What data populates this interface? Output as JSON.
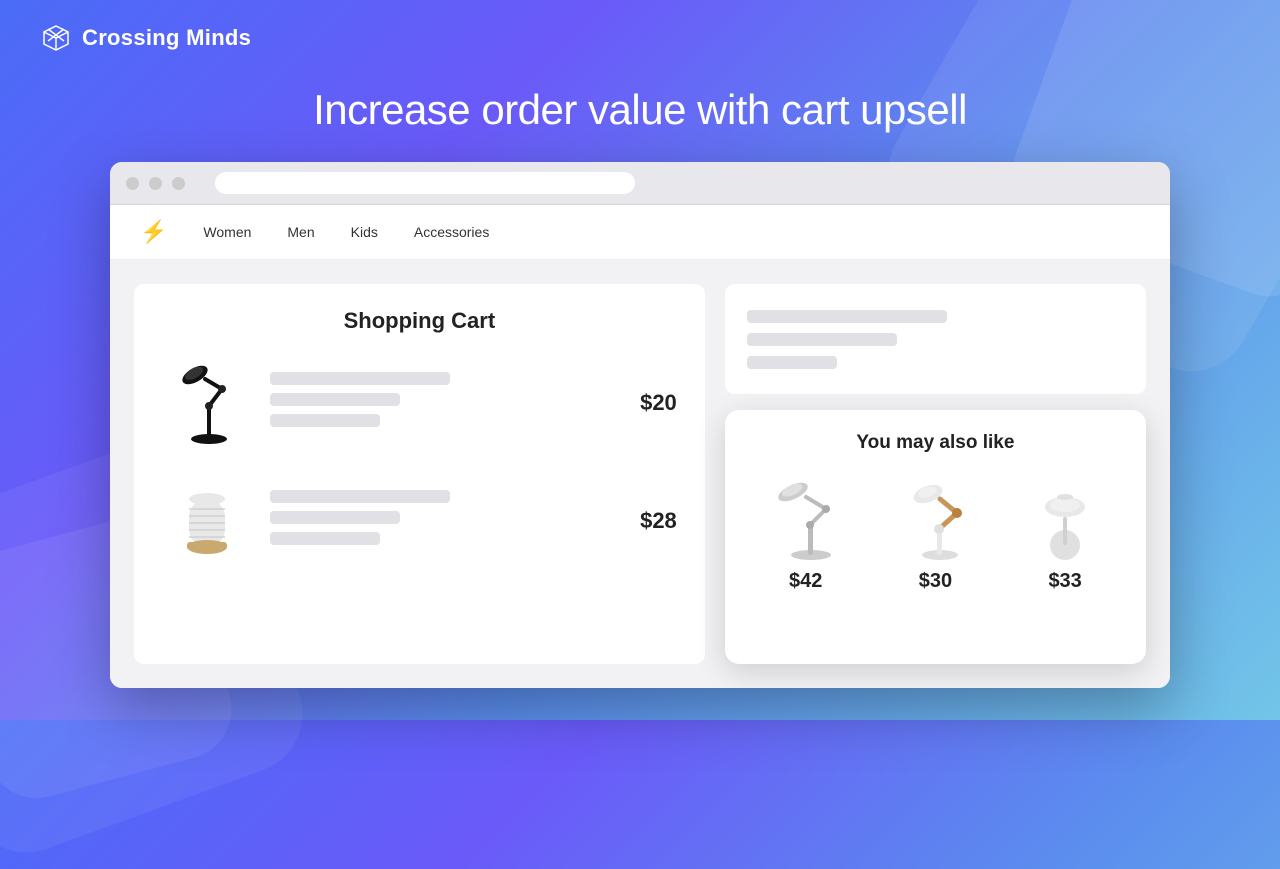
{
  "logo": {
    "text": "Crossing Minds"
  },
  "hero": {
    "title": "Increase order value with cart upsell"
  },
  "nav": {
    "items": [
      "Women",
      "Men",
      "Kids",
      "Accessories"
    ]
  },
  "cart": {
    "title": "Shopping Cart",
    "items": [
      {
        "price": "$20"
      },
      {
        "price": "$28"
      }
    ]
  },
  "upsell": {
    "title": "You may also like",
    "products": [
      {
        "price": "$42"
      },
      {
        "price": "$30"
      },
      {
        "price": "$33"
      }
    ]
  }
}
